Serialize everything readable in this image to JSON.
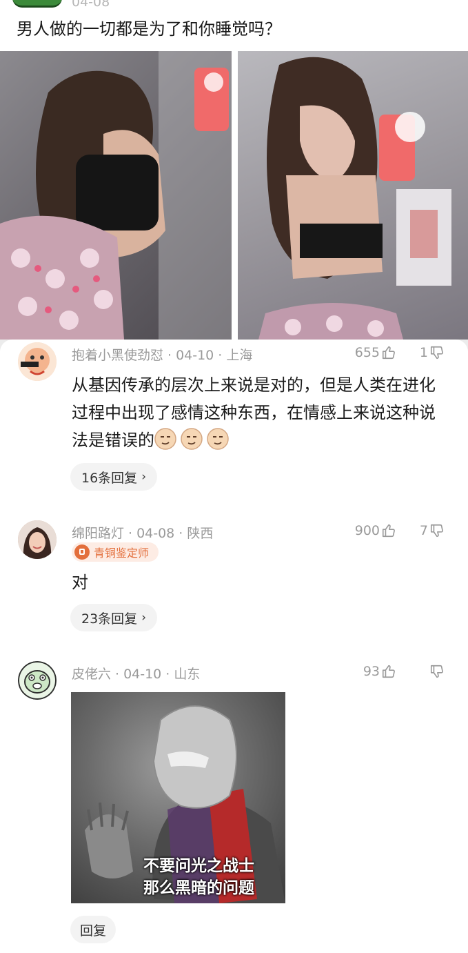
{
  "post": {
    "date": "04-08",
    "title": "男人做的一切都是为了和你睡觉吗？"
  },
  "comments": [
    {
      "author": "抱着小黑使劲怼",
      "date": "04-10",
      "location": "上海",
      "likes": "655",
      "dislikes": "1",
      "text": "从基因传承的层次上来说是对的，但是人类在进化过程中出现了感情这种东西，在情感上来说这种说法是错误的",
      "emoji": [
        "smirk-face-icon",
        "smirk-face-icon",
        "smirk-face-icon"
      ],
      "replies": "16条回复"
    },
    {
      "author": "绵阳路灯",
      "date": "04-08",
      "location": "陕西",
      "likes": "900",
      "dislikes": "7",
      "badge": "青铜鉴定师",
      "text": "对",
      "replies": "23条回复"
    },
    {
      "author": "皮佬六",
      "date": "04-10",
      "location": "山东",
      "likes": "93",
      "dislikes": "",
      "image_caption": [
        "不要问光之战士",
        "那么黑暗的问题"
      ],
      "reply": "回复"
    }
  ],
  "separator": "·",
  "colors": {
    "meta": "#9a9a9a",
    "badge": "#e36f3c",
    "card": "#ffffff",
    "page_bg": "#ececec"
  }
}
